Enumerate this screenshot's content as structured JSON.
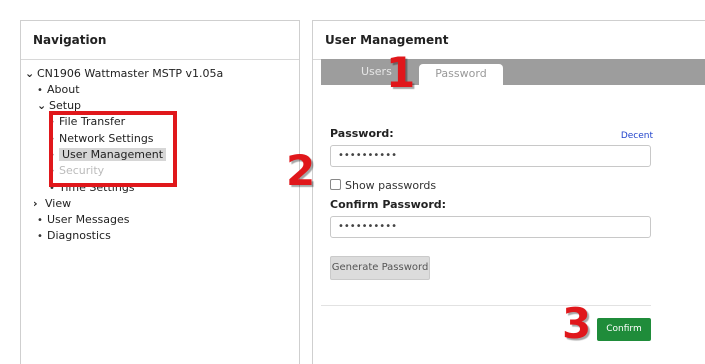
{
  "navigation": {
    "title": "Navigation",
    "tree": [
      {
        "label": "CN1906 Wattmaster MSTP v1.05a",
        "marker": "chevron-down"
      },
      {
        "label": "About",
        "marker": "bullet"
      },
      {
        "label": "Setup",
        "marker": "chevron-down"
      },
      {
        "label": "File Transfer",
        "marker": "bullet"
      },
      {
        "label": "Network Settings",
        "marker": "bullet"
      },
      {
        "label": "User Management",
        "marker": "bullet",
        "selected": true
      },
      {
        "label": "Security",
        "marker": "bullet"
      },
      {
        "label": "Time Settings",
        "marker": "bullet"
      },
      {
        "label": "View",
        "marker": "chevron-right"
      },
      {
        "label": "User Messages",
        "marker": "bullet"
      },
      {
        "label": "Diagnostics",
        "marker": "bullet"
      }
    ]
  },
  "content": {
    "title": "User Management",
    "tabs": [
      {
        "label": "Users",
        "active": false
      },
      {
        "label": "Password",
        "active": true
      }
    ],
    "password_label": "Password:",
    "password_strength": "Decent",
    "password_value": "••••••••••",
    "show_passwords_label": "Show passwords",
    "confirm_password_label": "Confirm Password:",
    "confirm_password_value": "••••••••••",
    "generate_button": "Generate Password",
    "confirm_button": "Confirm"
  },
  "callouts": {
    "one": "1",
    "two": "2",
    "three": "3"
  },
  "colors": {
    "annotation_red": "#e0171b",
    "confirm_green": "#1f8c3a",
    "tab_bar_gray": "#9d9d9d",
    "strength_blue": "#2244cc"
  }
}
